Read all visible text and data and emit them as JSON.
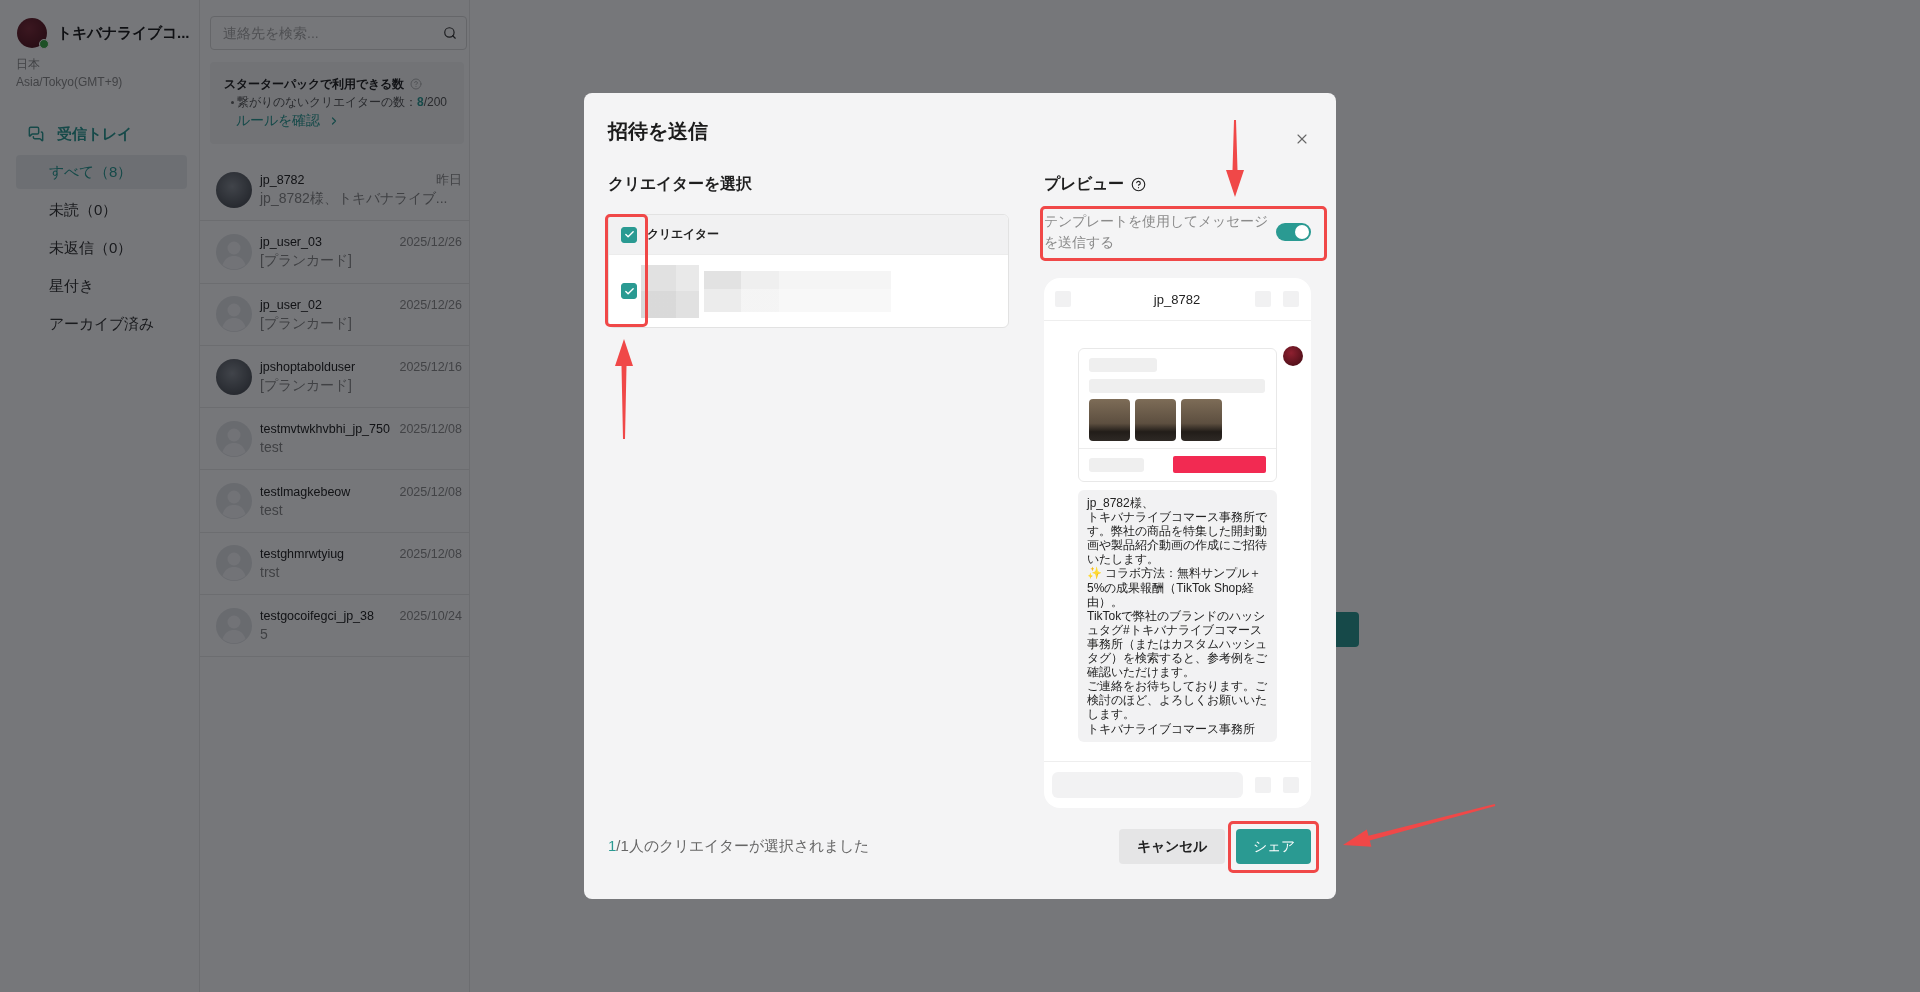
{
  "sidebar": {
    "account": {
      "name": "トキバナライブコ...",
      "online": true,
      "country": "日本",
      "timezone": "Asia/Tokyo(GMT+9)"
    },
    "section": "受信トレイ",
    "items": [
      {
        "label": "すべて（8）",
        "selected": true
      },
      {
        "label": "未読（0）",
        "selected": false
      },
      {
        "label": "未返信（0）",
        "selected": false
      },
      {
        "label": "星付き",
        "selected": false
      },
      {
        "label": "アーカイブ済み",
        "selected": false
      }
    ]
  },
  "contacts": {
    "search": {
      "placeholder": "連絡先を検索..."
    },
    "quota": {
      "title": "スターターパックで利用できる数",
      "label": "繋がりのないクリエイターの数：",
      "used": "8",
      "limit": "/200",
      "link": "ルールを確認"
    },
    "conversations": [
      {
        "kind": "photo",
        "name": "jp_8782",
        "date": "昨日",
        "preview": "jp_8782様、トキバナライブ..."
      },
      {
        "kind": "default",
        "name": "jp_user_03",
        "date": "2025/12/26",
        "preview": "[プランカード]"
      },
      {
        "kind": "default",
        "name": "jp_user_02",
        "date": "2025/12/26",
        "preview": "[プランカード]"
      },
      {
        "kind": "photo",
        "name": "jpshoptabolduser",
        "date": "2025/12/16",
        "preview": "[プランカード]"
      },
      {
        "kind": "default",
        "name": "testmvtwkhvbhi_jp_750",
        "date": "2025/12/08",
        "preview": "test"
      },
      {
        "kind": "default",
        "name": "testlmagkebeow",
        "date": "2025/12/08",
        "preview": "test"
      },
      {
        "kind": "default",
        "name": "testghmrwtyiug",
        "date": "2025/12/08",
        "preview": "trst"
      },
      {
        "kind": "default",
        "name": "testgocoifegci_jp_38",
        "date": "2025/10/24",
        "preview": "5"
      }
    ]
  },
  "main_panel": {
    "action_button": true
  },
  "dialog": {
    "title": "招待を送信",
    "creators": {
      "heading": "クリエイターを選択",
      "column": "クリエイター",
      "all_checked": true,
      "highlighted": true,
      "rows": [
        {
          "checked": true
        }
      ]
    },
    "preview": {
      "heading": "プレビュー",
      "template_toggle": {
        "label": "テンプレートを使用してメッセージを送信する",
        "on": true,
        "highlighted": true
      },
      "chat": {
        "contact": "jp_8782",
        "message": [
          "jp_8782様、",
          "トキバナライブコマース事務所です。弊社の商品を特集した開封動画や製品紹介動画の作成にご招待いたします。",
          "✨ コラボ方法：無料サンプル＋5%の成果報酬（TikTok Shop経由）。",
          "TikTokで弊社のブランドのハッシュタグ#トキバナライブコマース事務所（またはカスタムハッシュタグ）を検索すると、参考例をご確認いただけます。",
          "ご連絡をお待ちしております。ご検討のほど、よろしくお願いいたします。",
          "トキバナライブコマース事務所"
        ]
      }
    },
    "footer": {
      "selected_count": "1",
      "summary": "/1人のクリエイターが選択されました",
      "buttons": [
        {
          "kind": "secondary",
          "label": "キャンセル",
          "highlighted": false
        },
        {
          "kind": "primary",
          "label": "シェア",
          "highlighted": true
        }
      ]
    }
  }
}
